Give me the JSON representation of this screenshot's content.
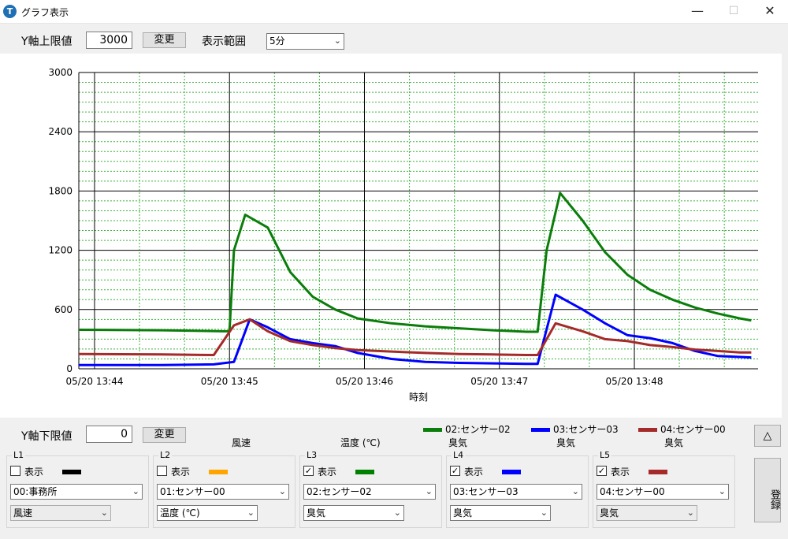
{
  "window": {
    "title": "グラフ表示",
    "min_glyph": "—",
    "max_glyph": "☐",
    "close_glyph": "✕"
  },
  "toolbar": {
    "y_max_label": "Y軸上限値",
    "y_max_value": "3000",
    "change_label": "変更",
    "range_label": "表示範囲",
    "range_value": "5分"
  },
  "bottom": {
    "y_min_label": "Y軸下限値",
    "y_min_value": "0",
    "change_label": "変更",
    "collapse_glyph": "△",
    "register_label": "登録"
  },
  "series_labels": [
    {
      "text": "風速"
    },
    {
      "text": "温度 (℃)"
    },
    {
      "text": "臭気"
    },
    {
      "text": "臭気"
    },
    {
      "text": "臭気"
    }
  ],
  "groups": [
    {
      "title": "L1",
      "checked": false,
      "check_glyph": "",
      "show_label": "表示",
      "color": "#000000",
      "name": "00:事務所",
      "unit": "風速",
      "unit_gray": true
    },
    {
      "title": "L2",
      "checked": false,
      "check_glyph": "",
      "show_label": "表示",
      "color": "#ffa500",
      "name": "01:センサー00",
      "unit": "温度 (℃)",
      "unit_gray": false
    },
    {
      "title": "L3",
      "checked": true,
      "check_glyph": "✓",
      "show_label": "表示",
      "color": "#008000",
      "name": "02:センサー02",
      "unit": "臭気",
      "unit_gray": false
    },
    {
      "title": "L4",
      "checked": true,
      "check_glyph": "✓",
      "show_label": "表示",
      "color": "#0000ff",
      "name": "03:センサー03",
      "unit": "臭気",
      "unit_gray": false
    },
    {
      "title": "L5",
      "checked": true,
      "check_glyph": "✓",
      "show_label": "表示",
      "color": "#a52a2a",
      "name": "04:センサー00",
      "unit": "臭気",
      "unit_gray": true
    }
  ],
  "chart_data": {
    "type": "line",
    "xlabel": "時刻",
    "ylabel": "",
    "ylim": [
      0,
      3000
    ],
    "yticks": [
      "0",
      "600",
      "1200",
      "1800",
      "2400",
      "3000"
    ],
    "xticks": [
      "05/20 13:44",
      "05/20 13:45",
      "05/20 13:46",
      "05/20 13:47",
      "05/20 13:48"
    ],
    "xlim": [
      "13:43:53",
      "13:48:55"
    ],
    "grid": true,
    "legend_position": "top-right below plot",
    "series": [
      {
        "name": "02:センサー02",
        "color": "#0a7d0a",
        "x": [
          "13:43:53",
          "13:44:30",
          "13:44:57",
          "13:45:00",
          "13:45:02",
          "13:45:07",
          "13:45:17",
          "13:45:27",
          "13:45:37",
          "13:45:47",
          "13:45:57",
          "13:46:12",
          "13:46:27",
          "13:46:42",
          "13:46:57",
          "13:47:12",
          "13:47:17",
          "13:47:21",
          "13:47:27",
          "13:47:37",
          "13:47:47",
          "13:47:57",
          "13:48:07",
          "13:48:17",
          "13:48:27",
          "13:48:37",
          "13:48:47",
          "13:48:52"
        ],
        "values": [
          395,
          390,
          380,
          380,
          1200,
          1560,
          1430,
          980,
          730,
          600,
          510,
          460,
          430,
          410,
          390,
          375,
          375,
          1200,
          1780,
          1500,
          1180,
          950,
          800,
          700,
          620,
          560,
          510,
          490
        ]
      },
      {
        "name": "03:センサー03",
        "color": "#0000ff",
        "x": [
          "13:43:53",
          "13:44:30",
          "13:44:53",
          "13:45:02",
          "13:45:09",
          "13:45:17",
          "13:45:27",
          "13:45:37",
          "13:45:47",
          "13:45:57",
          "13:46:12",
          "13:46:27",
          "13:46:42",
          "13:46:57",
          "13:47:12",
          "13:47:17",
          "13:47:25",
          "13:47:37",
          "13:47:47",
          "13:47:57",
          "13:48:07",
          "13:48:17",
          "13:48:27",
          "13:48:37",
          "13:48:47",
          "13:48:52"
        ],
        "values": [
          38,
          38,
          45,
          70,
          500,
          420,
          300,
          260,
          230,
          160,
          100,
          70,
          60,
          55,
          50,
          50,
          750,
          600,
          460,
          340,
          310,
          260,
          180,
          130,
          120,
          115
        ]
      },
      {
        "name": "04:センサー00",
        "color": "#a52a2a",
        "x": [
          "13:43:53",
          "13:44:30",
          "13:44:53",
          "13:45:02",
          "13:45:09",
          "13:45:17",
          "13:45:27",
          "13:45:37",
          "13:45:47",
          "13:45:57",
          "13:46:12",
          "13:46:27",
          "13:46:42",
          "13:46:57",
          "13:47:12",
          "13:47:17",
          "13:47:25",
          "13:47:37",
          "13:47:47",
          "13:47:57",
          "13:48:07",
          "13:48:17",
          "13:48:27",
          "13:48:37",
          "13:48:47",
          "13:48:52"
        ],
        "values": [
          150,
          145,
          140,
          440,
          500,
          380,
          280,
          240,
          210,
          190,
          175,
          160,
          150,
          145,
          140,
          140,
          460,
          380,
          300,
          280,
          240,
          220,
          195,
          180,
          165,
          165
        ]
      }
    ]
  }
}
